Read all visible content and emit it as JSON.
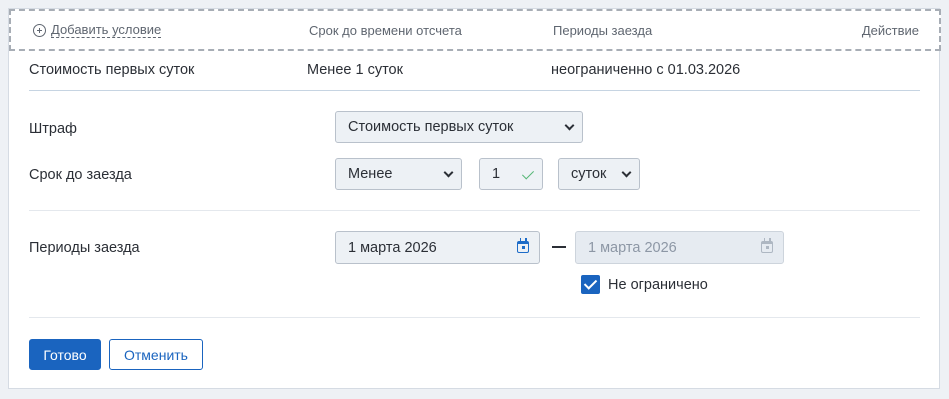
{
  "header": {
    "add_condition": "Добавить условие",
    "col_term": "Срок до времени отсчета",
    "col_periods": "Периоды заезда",
    "col_action": "Действие"
  },
  "summary": {
    "fine": "Стоимость первых суток",
    "term": "Менее 1 суток",
    "periods": "неограниченно с 01.03.2026"
  },
  "form": {
    "fine_label": "Штраф",
    "fine_value": "Стоимость первых суток",
    "term_label": "Срок до заезда",
    "term_comparator": "Менее",
    "term_amount": "1",
    "term_unit": "суток",
    "periods_label": "Периоды заезда",
    "date_from": "1 марта 2026",
    "date_to_placeholder": "1 марта 2026",
    "unlimited_label": "Не ограничено",
    "unlimited_checked": true
  },
  "buttons": {
    "done": "Готово",
    "cancel": "Отменить"
  },
  "colors": {
    "accent": "#1a64bf",
    "valid_check": "#56b776",
    "page_bg": "#eef1f5"
  },
  "icons": [
    "plus-circle-icon",
    "chevron-down-icon",
    "checkmark-icon",
    "calendar-icon",
    "checkbox-checked-icon"
  ]
}
